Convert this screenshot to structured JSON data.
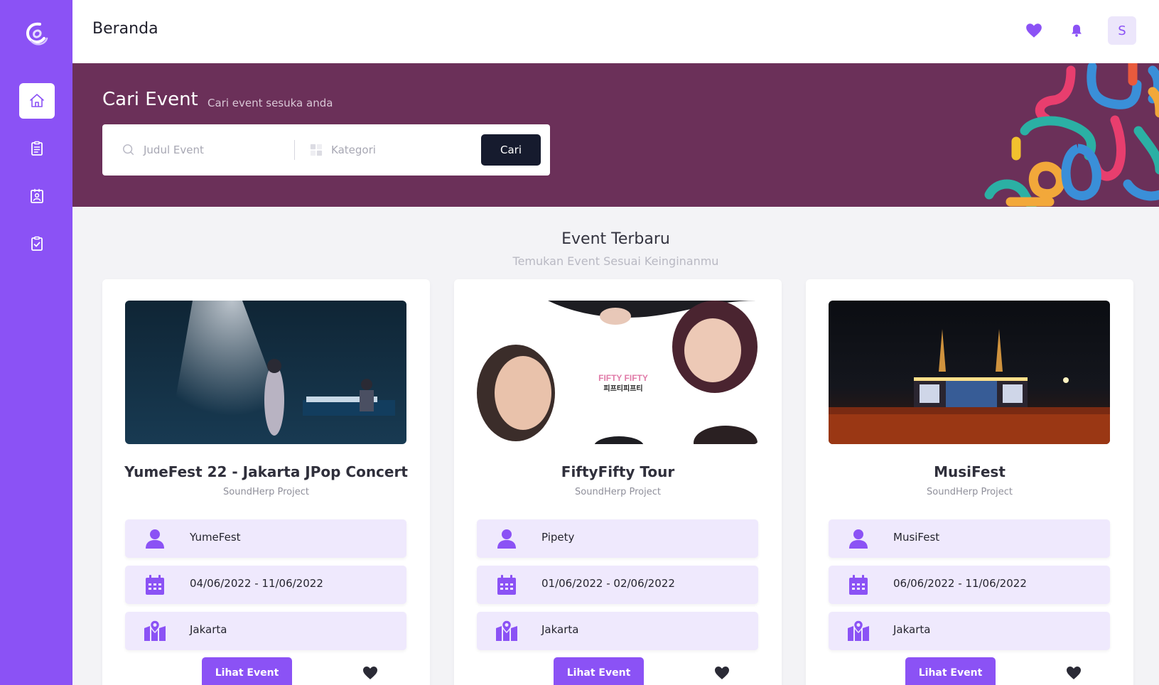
{
  "topbar": {
    "title": "Beranda",
    "avatar_initial": "S",
    "icons": [
      "heart-icon",
      "bell-icon"
    ]
  },
  "sidebar": {
    "items": [
      {
        "icon": "home-icon",
        "active": true
      },
      {
        "icon": "clipboard-list-icon",
        "active": false
      },
      {
        "icon": "contact-card-icon",
        "active": false
      },
      {
        "icon": "clipboard-check-icon",
        "active": false
      }
    ]
  },
  "hero": {
    "title": "Cari Event",
    "subtitle": "Cari event sesuka anda",
    "search_placeholder": "Judul Event",
    "category_placeholder": "Kategori",
    "search_button": "Cari"
  },
  "section": {
    "title": "Event Terbaru",
    "subtitle": "Temukan Event Sesuai Keinginanmu"
  },
  "events": [
    {
      "title": "YumeFest 22 - Jakarta JPop Concert",
      "organizer": "SoundHerp Project",
      "creator": "YumeFest",
      "dates": "04/06/2022 - 11/06/2022",
      "location": "Jakarta",
      "button": "Lihat Event"
    },
    {
      "title": "FiftyFifty Tour",
      "organizer": "SoundHerp Project",
      "creator": "Pipety",
      "dates": "01/06/2022 - 02/06/2022",
      "location": "Jakarta",
      "button": "Lihat Event",
      "poster_text_1": "FIFTY FIFTY",
      "poster_text_2": "피프티피프티"
    },
    {
      "title": "MusiFest",
      "organizer": "SoundHerp Project",
      "creator": "MusiFest",
      "dates": "06/06/2022 - 11/06/2022",
      "location": "Jakarta",
      "button": "Lihat Event"
    }
  ],
  "colors": {
    "primary": "#8b52f5",
    "hero_bg": "#6b3059",
    "dark_button": "#161b2e",
    "info_bg": "#efe9fd"
  }
}
